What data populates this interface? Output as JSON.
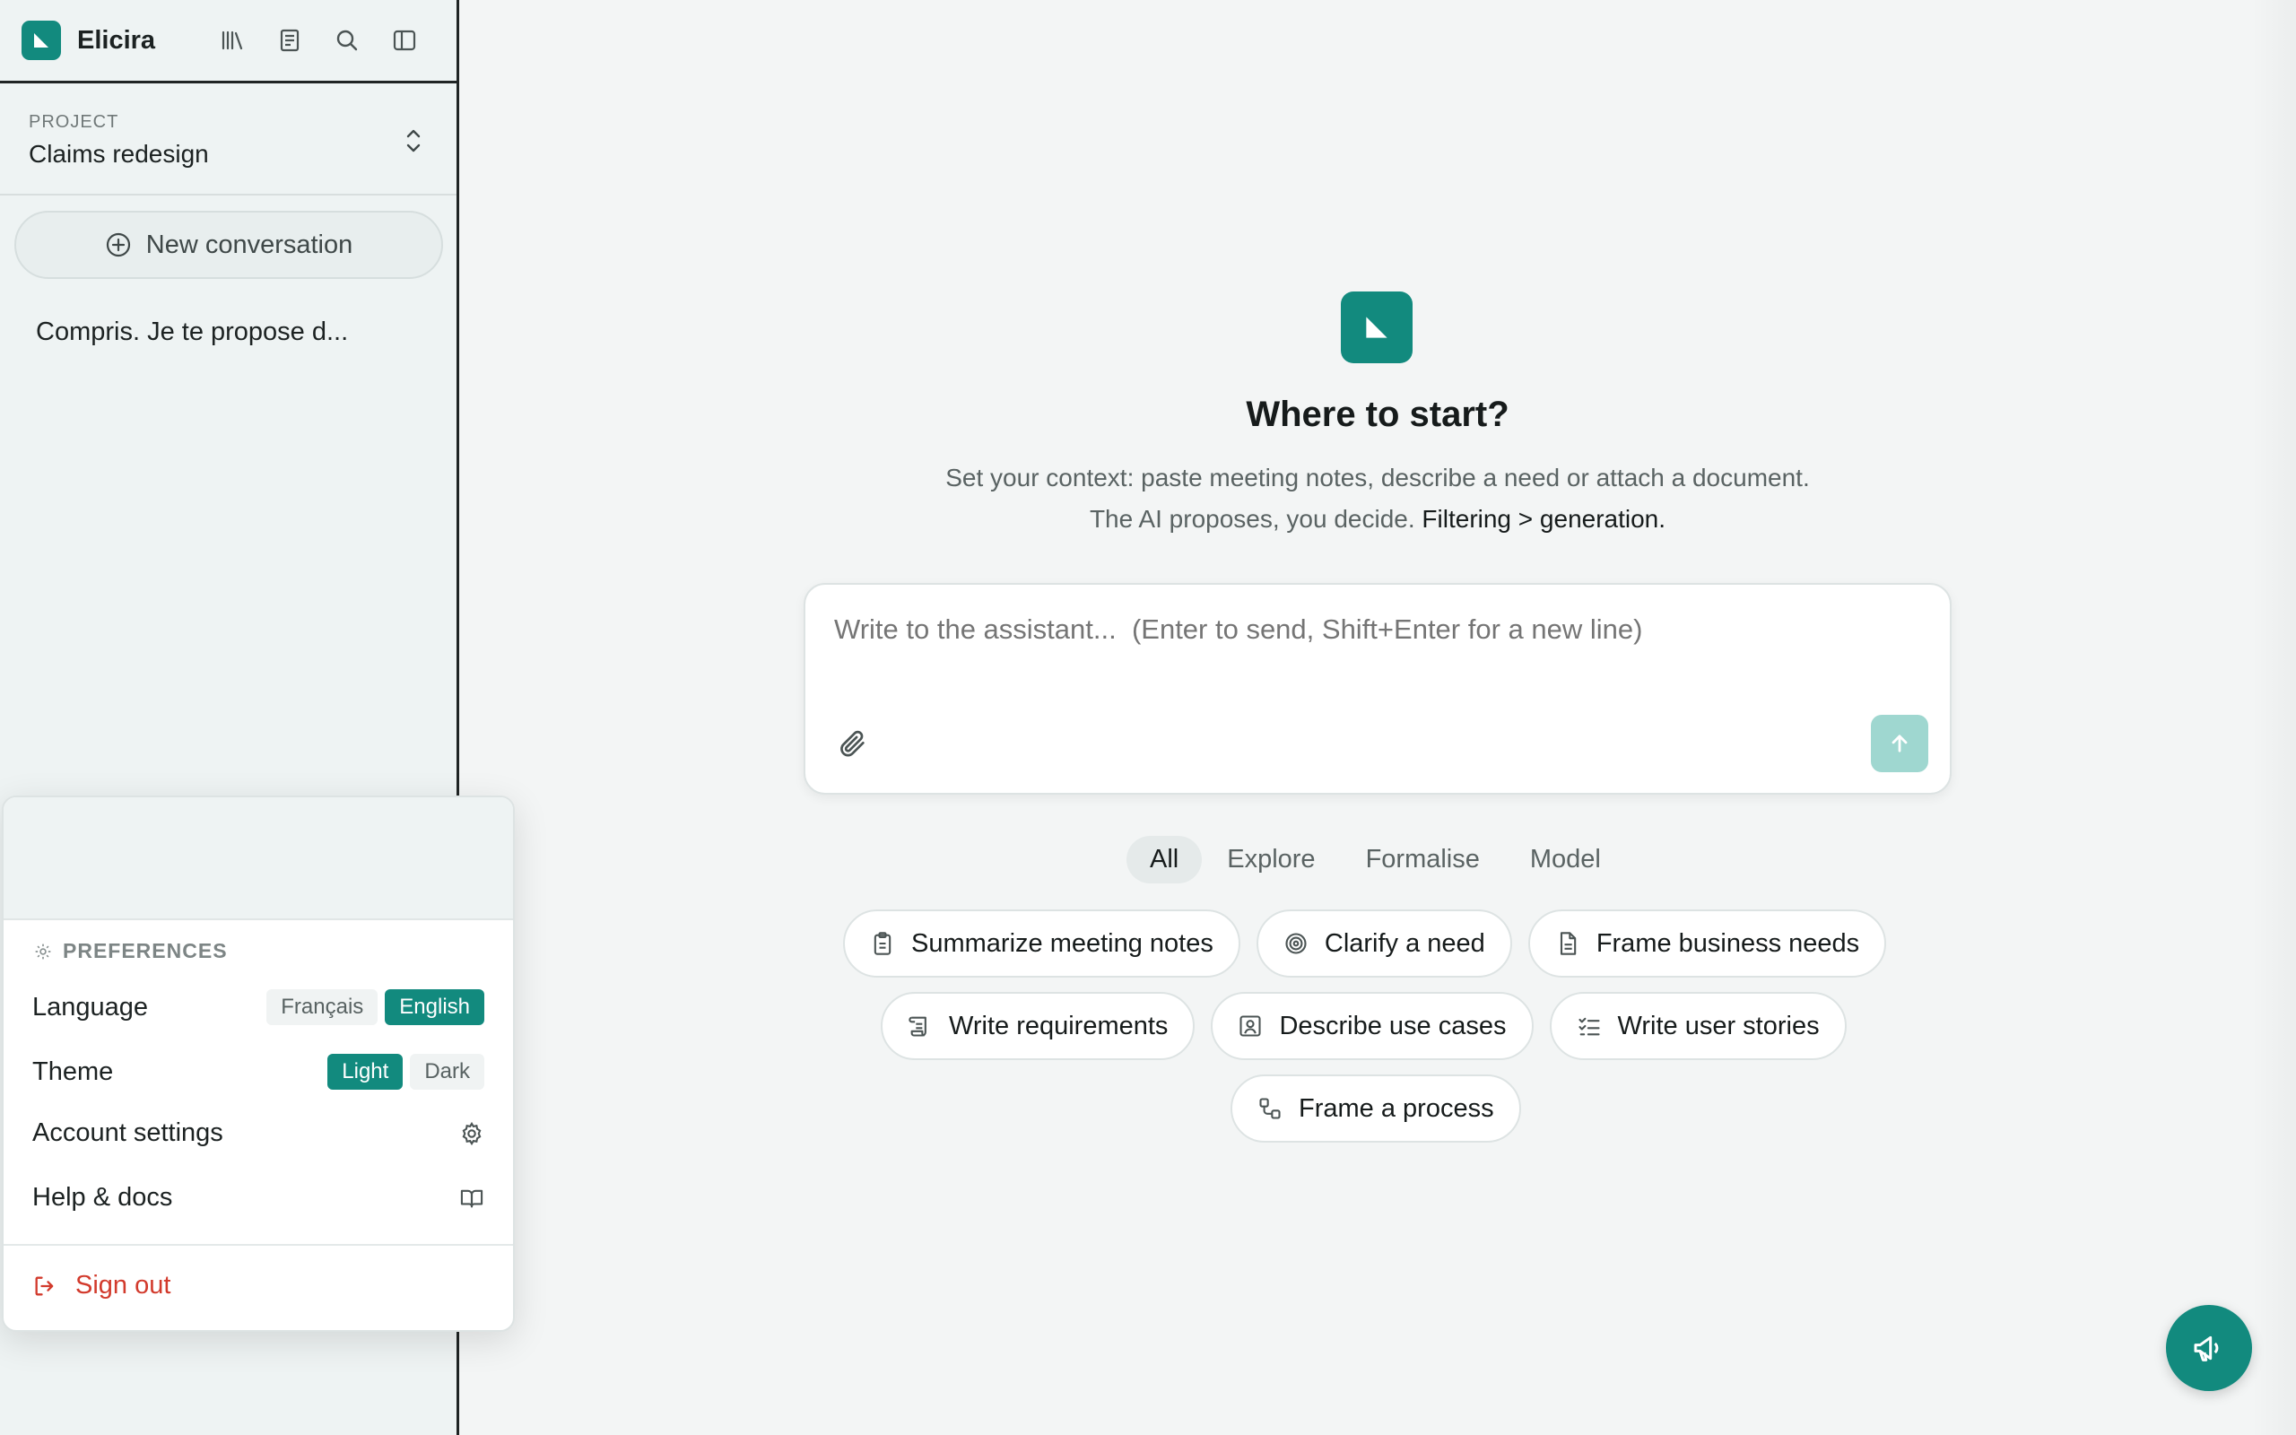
{
  "app": {
    "name": "Elicira"
  },
  "colors": {
    "accent": "#128a7e",
    "danger": "#d23a2c",
    "send_disabled": "#9fd7d0"
  },
  "header": {
    "icons": [
      "library-icon",
      "notebook-icon",
      "search-icon",
      "sidebar-toggle-icon"
    ]
  },
  "project": {
    "eyebrow": "PROJECT",
    "name": "Claims redesign"
  },
  "sidebar": {
    "new_conversation": "New conversation",
    "conversations": [
      "Compris. Je te propose d..."
    ]
  },
  "preferences": {
    "heading": "PREFERENCES",
    "language": {
      "label": "Language",
      "options": [
        "Français",
        "English"
      ],
      "selected": "English"
    },
    "theme": {
      "label": "Theme",
      "options": [
        "Light",
        "Dark"
      ],
      "selected": "Light"
    },
    "account_settings": "Account settings",
    "help_docs": "Help & docs",
    "sign_out": "Sign out"
  },
  "main": {
    "title": "Where to start?",
    "subtitle_part1": "Set your context: paste meeting notes, describe a need or attach a document. The AI proposes, you decide.",
    "subtitle_emphasis": "Filtering > generation.",
    "composer_placeholder": "Write to the assistant...  (Enter to send, Shift+Enter for a new line)",
    "tabs": [
      "All",
      "Explore",
      "Formalise",
      "Model"
    ],
    "active_tab": "All",
    "suggestions": [
      {
        "label": "Summarize meeting notes",
        "icon": "clipboard-icon"
      },
      {
        "label": "Clarify a need",
        "icon": "target-icon"
      },
      {
        "label": "Frame business needs",
        "icon": "document-icon"
      },
      {
        "label": "Write requirements",
        "icon": "scroll-icon"
      },
      {
        "label": "Describe use cases",
        "icon": "user-card-icon"
      },
      {
        "label": "Write user stories",
        "icon": "checklist-icon"
      },
      {
        "label": "Frame a process",
        "icon": "process-icon"
      }
    ]
  },
  "fab": {
    "icon": "megaphone-icon"
  }
}
